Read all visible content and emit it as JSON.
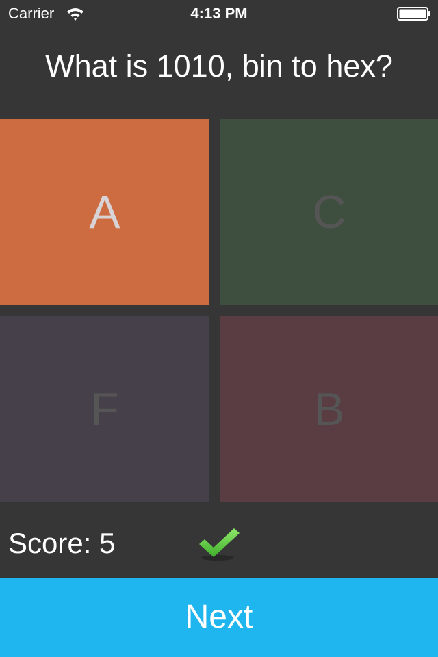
{
  "status_bar": {
    "carrier": "Carrier",
    "time": "4:13 PM",
    "icons": [
      "wifi-icon",
      "battery-icon"
    ]
  },
  "quiz": {
    "question": "What is 1010, bin to hex?",
    "options": [
      {
        "label": "A",
        "color": "#cd6c40",
        "state": "selected"
      },
      {
        "label": "C",
        "color": "#3f4f3f",
        "state": "dimmed"
      },
      {
        "label": "F",
        "color": "#46404a",
        "state": "dimmed"
      },
      {
        "label": "B",
        "color": "#593d42",
        "state": "dimmed"
      }
    ],
    "score_text": "Score: 5",
    "result_icon": "check-icon",
    "result_color": "#5fd04a",
    "next_label": "Next",
    "next_color": "#1fb5ee"
  }
}
